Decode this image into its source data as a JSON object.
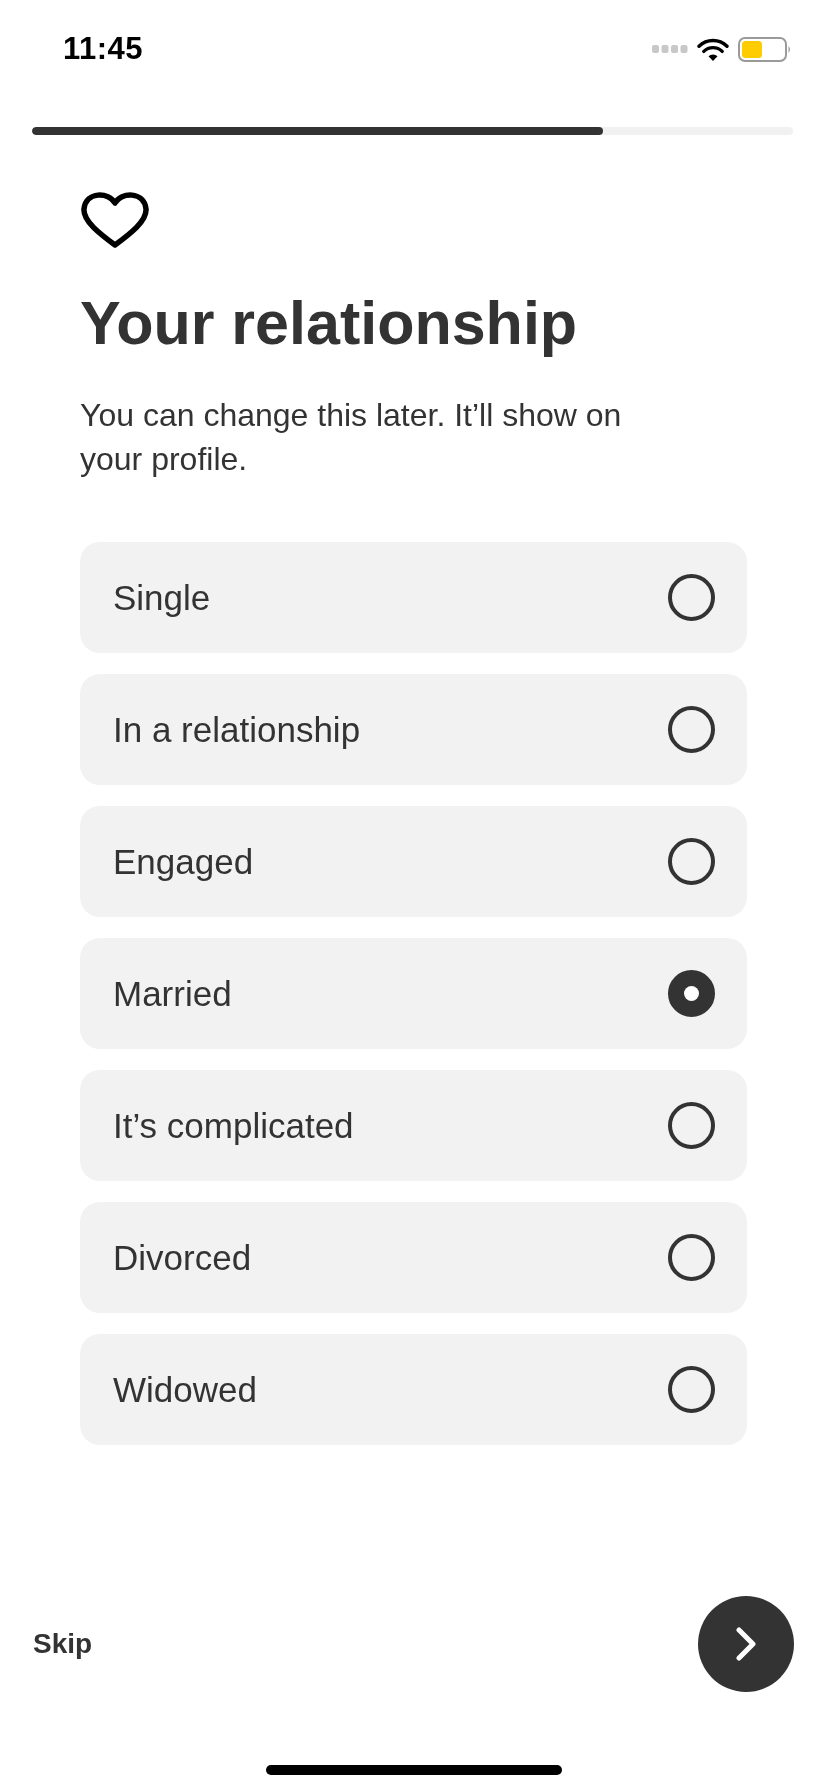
{
  "status_bar": {
    "time": "11:45"
  },
  "progress": {
    "level": 0.75
  },
  "heading": {
    "title": "Your relationship",
    "subtitle": "You can change this later. It’ll show on your profile."
  },
  "options": [
    {
      "label": "Single",
      "selected": false
    },
    {
      "label": "In a relationship",
      "selected": false
    },
    {
      "label": "Engaged",
      "selected": false
    },
    {
      "label": "Married",
      "selected": true
    },
    {
      "label": "It’s complicated",
      "selected": false
    },
    {
      "label": "Divorced",
      "selected": false
    },
    {
      "label": "Widowed",
      "selected": false
    }
  ],
  "footer": {
    "skip": "Skip"
  }
}
